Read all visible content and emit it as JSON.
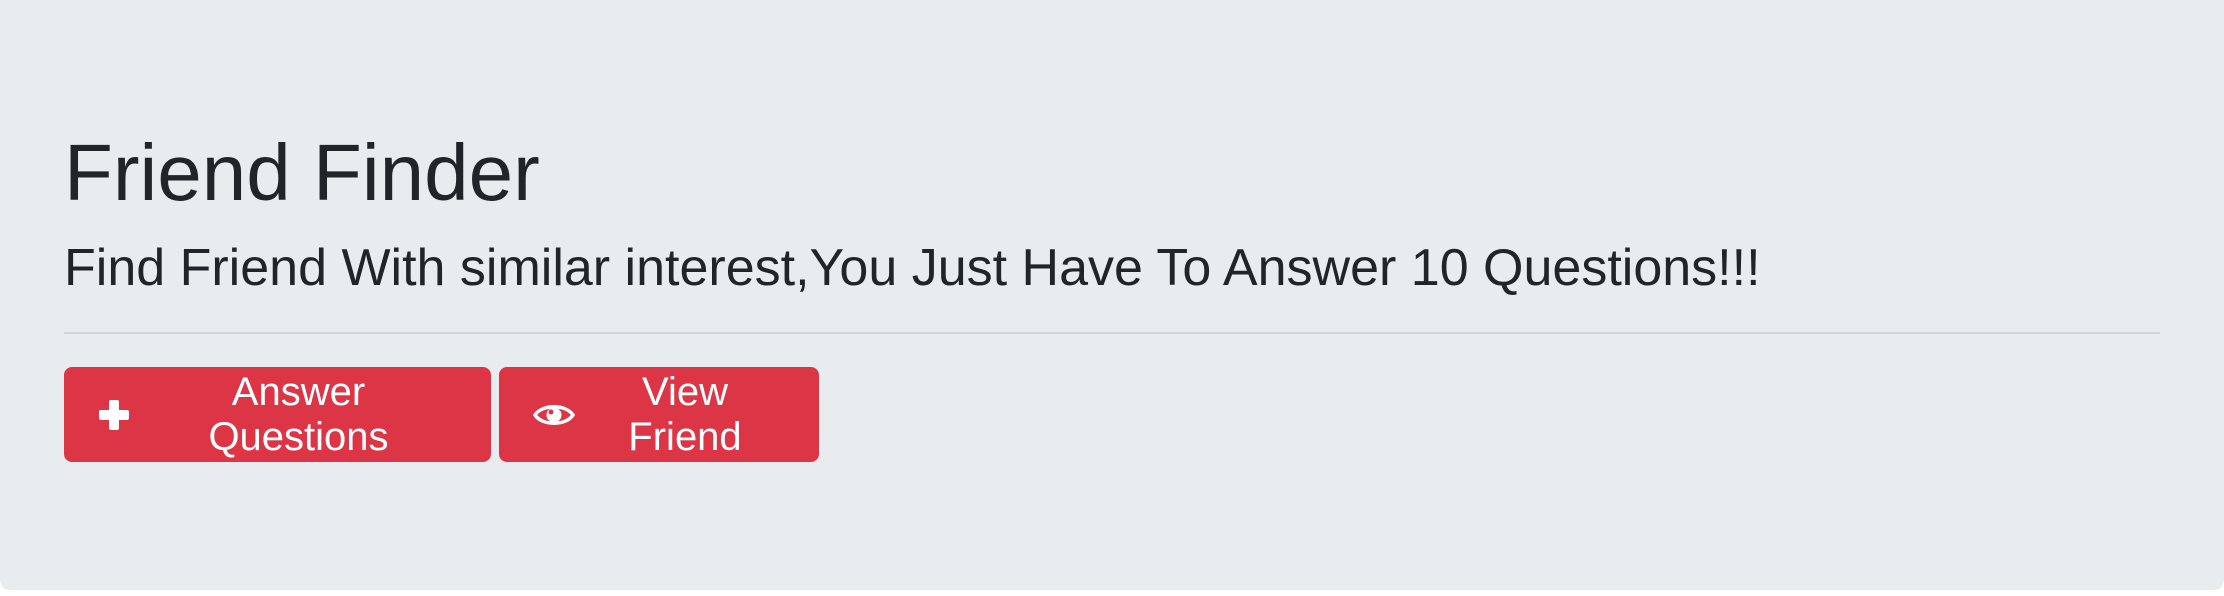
{
  "header": {
    "title": "Friend Finder",
    "subtitle": "Find Friend With similar interest,You Just Have To Answer 10 Questions!!!"
  },
  "actions": {
    "answer_label": "Answer Questions",
    "answer_icon": "plus-icon",
    "view_label": "View Friend",
    "view_icon": "eye-icon"
  },
  "colors": {
    "background": "#e9ecef",
    "button": "#dc3545",
    "text": "#212529"
  }
}
